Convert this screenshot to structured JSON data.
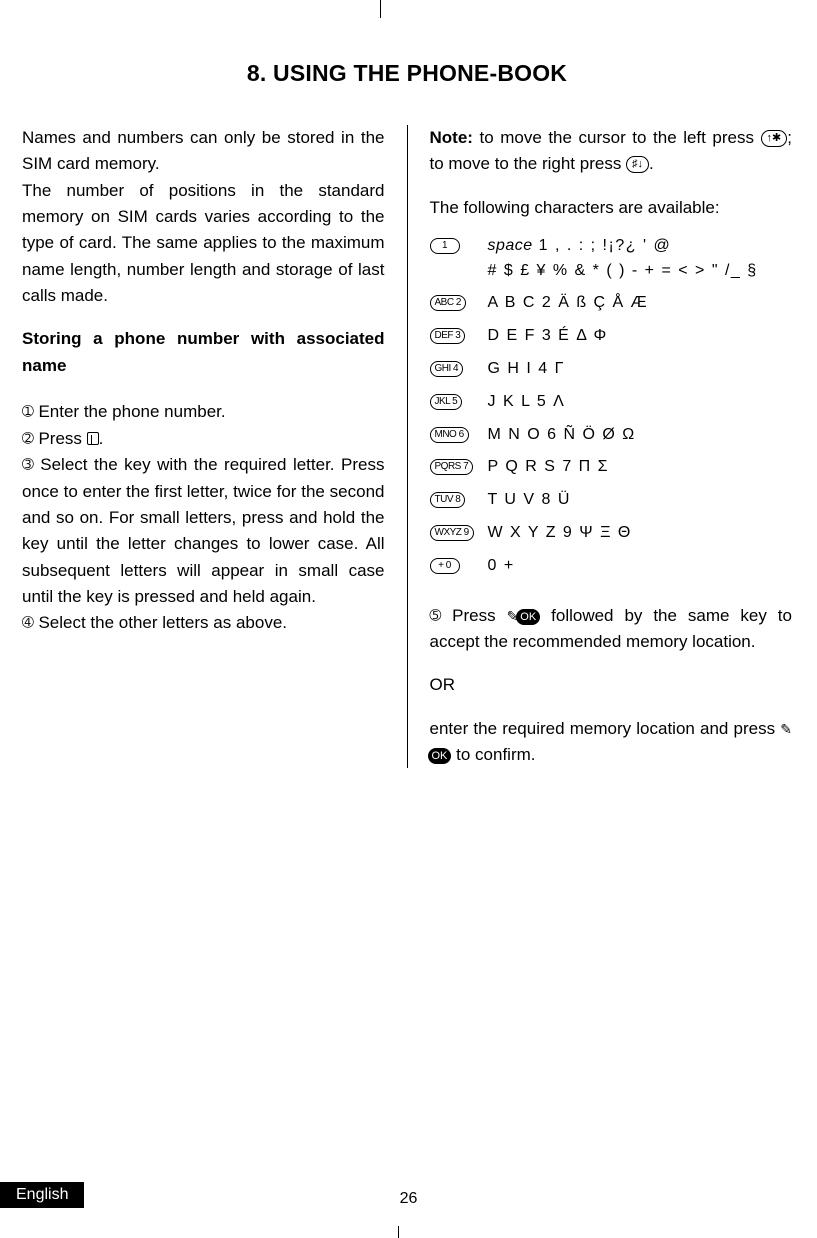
{
  "title": "8. USING THE PHONE-BOOK",
  "left": {
    "intro1": "Names and numbers can only be stored in the SIM card memory.",
    "intro2": "The number of positions in the standard memory on SIM cards varies according to the type of card. The same applies to the maximum name length, number length and storage of last calls made.",
    "subhead": "Storing a phone number with associa­ted name",
    "step1_num": "➀",
    "step1": " Enter the phone number.",
    "step2_num": "➁",
    "step2a": " Press ",
    "step2b": ".",
    "step3_num": "➂",
    "step3": " Select the key with the required letter. Press once to enter the first letter, twice for the second and so on. For small let­ters, press and hold the key until the letter changes to lower case. All subsequent letters will appear in small case until the key is pressed and held again.",
    "step4_num": "➃",
    "step4": " Select the other letters as above."
  },
  "right": {
    "note_label": "Note:",
    "note1a": " to move the cursor to the left press ",
    "note_key_left": "↑✱",
    "note1b": "; to move to the right press ",
    "note_key_right": "♯↓",
    "note1c": ".",
    "avail": "The following characters are available:",
    "keys": [
      {
        "key": "1",
        "chars": "<em>space</em>  1 , . : ; !¡?¿ ' @<br># $ £ ¥ % & * ( ) - + = < > \" /_ §"
      },
      {
        "key": "ABC 2",
        "chars": "A B C 2  Ä ß Ç Å Æ"
      },
      {
        "key": "DEF 3",
        "chars": "D E F 3  É Δ Φ"
      },
      {
        "key": "GHI 4",
        "chars": "G H I  4  Γ"
      },
      {
        "key": "JKL 5",
        "chars": "J K L  5  Λ"
      },
      {
        "key": "MNO 6",
        "chars": "M N O  6  Ñ Ö Ø Ω"
      },
      {
        "key": "PQRS 7",
        "chars": "P Q R S  7  Π  Σ"
      },
      {
        "key": "TUV 8",
        "chars": "T U V  8  Ü"
      },
      {
        "key": "WXYZ 9",
        "chars": "W X Y Z  9  Ψ Ξ Θ"
      },
      {
        "key": "+ 0",
        "chars": "0 +"
      }
    ],
    "step5_num": "➄",
    "step5a": " Press ",
    "ok_label": "OK",
    "step5b": " followed by the same key to accept the recommended memory lo­cation.",
    "or": "OR",
    "alt_a": "enter the required memory location and press ",
    "alt_b": " to confirm."
  },
  "footer": {
    "lang": "English",
    "page": "26"
  }
}
